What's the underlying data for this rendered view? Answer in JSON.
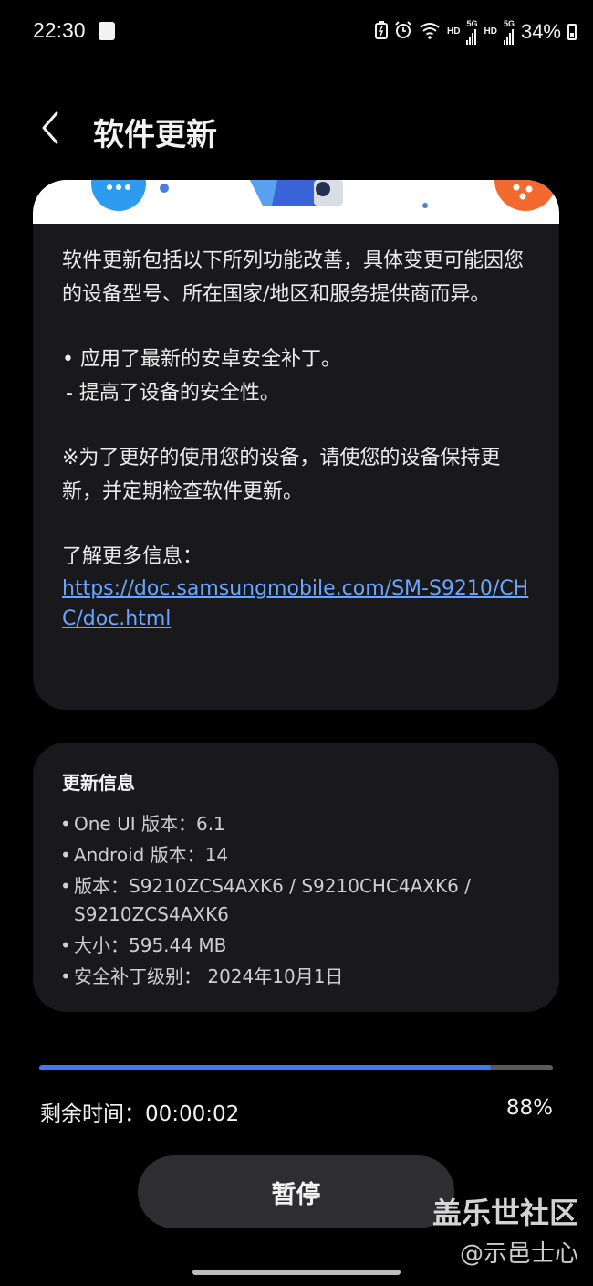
{
  "status_bar": {
    "time": "22:30",
    "net_hd_1": "HD",
    "net_5g_1": "5G",
    "net_hd_2": "HD",
    "net_5g_2": "5G",
    "battery": "34%",
    "icons": [
      "app-notification-icon",
      "battery-saver-icon",
      "alarm-icon",
      "wifi-icon",
      "signal-icon",
      "battery-icon"
    ]
  },
  "header": {
    "title": "软件更新",
    "back_icon": "chevron-left-icon"
  },
  "release_notes": {
    "intro": "软件更新包括以下所列功能改善，具体变更可能因您的设备型号、所在国家/地区和服务提供商而异。",
    "bullet": "• 应用了最新的安卓安全补丁。",
    "sub_bullet": "- 提高了设备的安全性。",
    "note": "※为了更好的使用您的设备，请使您的设备保持更新，并定期检查软件更新。",
    "more_info_label": "了解更多信息：",
    "link": "https://doc.samsungmobile.com/SM-S9210/CHC/doc.html"
  },
  "update_info": {
    "title": "更新信息",
    "items": [
      "One UI 版本：6.1",
      "Android 版本：14",
      "版本：S9210ZCS4AXK6 / S9210CHC4AXK6 / S9210ZCS4AXK6",
      "大小：595.44 MB",
      "安全补丁级别： 2024年10月1日"
    ]
  },
  "progress": {
    "value": 0.88,
    "remaining_label": "剩余时间：00:00:02",
    "percent_label": "88%"
  },
  "pause_button": {
    "label": "暂停"
  },
  "watermark": {
    "site": "盖乐世社区",
    "user": "@示邑士心"
  },
  "colors": {
    "background": "#000000",
    "card": "#19191b",
    "accent": "#3e7bf2",
    "link": "#6aa5ff",
    "button": "#2e2e30"
  }
}
